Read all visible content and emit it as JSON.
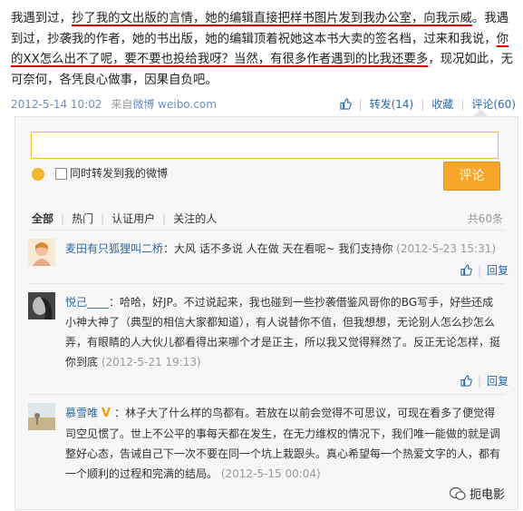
{
  "post": {
    "seg1": "我遇到过，",
    "seg2": "抄了我的文出版的言情，她的编辑直接把样书图片发到我办公室，向我示威",
    "seg3": "。我遇到过，抄袭我的作者，她的书出版，她的编辑顶着祝她这本书大卖的签名档，过来和我说，",
    "seg4": "你的XX怎么出不了呢，要不要也投给我呀？当然，有很多作者遇到的比我还要多",
    "seg5": "，现况如此，无可奈何，各凭良心做事，因果自负吧。"
  },
  "meta": {
    "date": "2012-5-14 10:02",
    "source_prefix": "来自",
    "source_name": "微博 weibo.com"
  },
  "actions": {
    "forward": "转发(14)",
    "favorite": "收藏",
    "comment": "评论(60)"
  },
  "composer": {
    "checkbox_label": "同时转发到我的微博",
    "submit": "评论"
  },
  "tabs": {
    "all": "全部",
    "popular": "热门",
    "verified": "认证用户",
    "following": "关注的人",
    "count": "共60条"
  },
  "comments": [
    {
      "name": "麦田有只狐狸叫二桥",
      "text": "：大风 话不多说 人在做 天在看呢~ 我们支持你",
      "date": "(2012-5-23 15:31)"
    },
    {
      "name": "悦己____",
      "text": "：哈哈，好JP。不过说起来，我也碰到一些抄袭借鉴风哥你的BG写手，好些还成小神大神了（典型的相信大家都知道），有人说替你不值，但我想想，无论别人怎么抄怎么弄，有眼睛的人大伙儿都看得出来哪个才是正主，所以我又觉得释然了。反正无论怎样，挺你到底",
      "date": "(2012-5-21 19:13)"
    },
    {
      "name": "慕雪唯",
      "vip": "V",
      "text": "：林子大了什么样的鸟都有。若放在以前会觉得不可思议，可现在看多了便觉得司空见惯了。世上不公平的事每天都在发生，在无力维权的情况下，我们唯一能做的就是调整好心态，告诫自己下一次不要在同一个坑上栽跟头。真心希望每一个热爱文字的人，都有一个顺利的过程和完满的结局。",
      "date": "(2012-5-15 00:04)"
    }
  ],
  "reply_label": "回复",
  "watermark": "扼电影"
}
